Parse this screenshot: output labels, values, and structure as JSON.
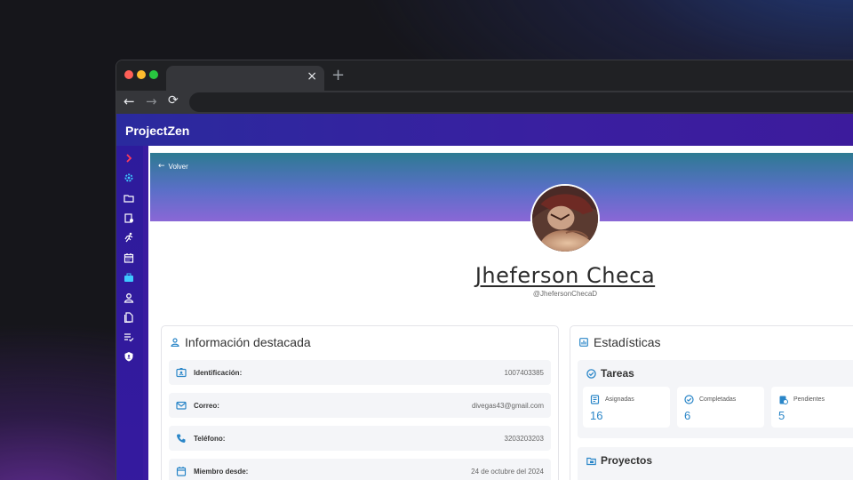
{
  "browser": {
    "tab_close": "×",
    "new_tab": "+",
    "back": "←",
    "forward": "→",
    "reload": "⟳"
  },
  "app": {
    "brand": "ProjectZen"
  },
  "sidebar": {
    "items": [
      {
        "name": "expand-chevron-icon",
        "color": "#ff3b5c"
      },
      {
        "name": "gear-icon",
        "color": "#3ec8ff"
      },
      {
        "name": "folder-icon",
        "color": "#ffffff"
      },
      {
        "name": "clipboard-icon",
        "color": "#ffffff"
      },
      {
        "name": "runner-icon",
        "color": "#ffffff"
      },
      {
        "name": "calendar-icon",
        "color": "#ffffff"
      },
      {
        "name": "briefcase-icon",
        "color": "#3ec8ff"
      },
      {
        "name": "user-icon",
        "color": "#ffffff"
      },
      {
        "name": "document-icon",
        "color": "#ffffff"
      },
      {
        "name": "checklist-icon",
        "color": "#ffffff"
      },
      {
        "name": "shield-icon",
        "color": "#ffffff"
      }
    ]
  },
  "profile": {
    "back_label": "Volver",
    "name": "Jheferson Checa",
    "handle": "@JhefersonChecaD"
  },
  "info": {
    "title": "Información destacada",
    "rows": [
      {
        "label": "Identificación:",
        "value": "1007403385",
        "icon": "id-card-icon"
      },
      {
        "label": "Correo:",
        "value": "divegas43@gmail.com",
        "icon": "mail-icon"
      },
      {
        "label": "Teléfono:",
        "value": "3203203203",
        "icon": "phone-icon"
      },
      {
        "label": "Miembro desde:",
        "value": "24 de octubre del 2024",
        "icon": "calendar-icon"
      }
    ]
  },
  "stats": {
    "title": "Estadísticas",
    "tasks": {
      "title": "Tareas",
      "items": [
        {
          "label": "Asignadas",
          "value": "16"
        },
        {
          "label": "Completadas",
          "value": "6"
        },
        {
          "label": "Pendientes",
          "value": "5"
        }
      ]
    },
    "projects": {
      "title": "Proyectos"
    }
  },
  "colors": {
    "accent": "#2a86c8",
    "appbar": "#2a2a9e"
  }
}
